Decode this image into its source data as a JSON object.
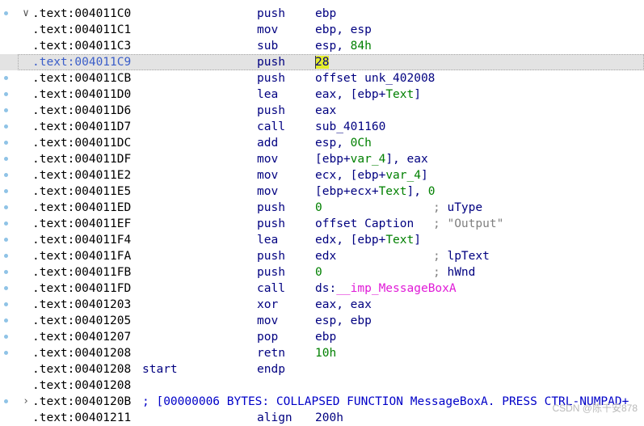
{
  "listing": {
    "rows": [
      {
        "addr": ".text:004011C0",
        "fold": "open",
        "bp": true,
        "mnem": "push",
        "ops": [
          {
            "t": "ebp"
          }
        ]
      },
      {
        "addr": ".text:004011C1",
        "mnem": "mov",
        "ops": [
          {
            "t": "ebp, esp"
          }
        ]
      },
      {
        "addr": ".text:004011C3",
        "mnem": "sub",
        "ops": [
          {
            "t": "esp, "
          },
          {
            "t": "84h",
            "c": "n"
          }
        ]
      },
      {
        "addr": ".text:004011C9",
        "selected": true,
        "mnem": "push",
        "ops": [
          {
            "t": "28",
            "c": "cursor-hl"
          }
        ]
      },
      {
        "addr": ".text:004011CB",
        "bp": true,
        "mnem": "push",
        "ops": [
          {
            "t": "offset unk_402008"
          }
        ]
      },
      {
        "addr": ".text:004011D0",
        "bp": true,
        "mnem": "lea",
        "ops": [
          {
            "t": "eax, [ebp+"
          },
          {
            "t": "Text",
            "c": "var"
          },
          {
            "t": "]"
          }
        ]
      },
      {
        "addr": ".text:004011D6",
        "bp": true,
        "mnem": "push",
        "ops": [
          {
            "t": "eax"
          }
        ]
      },
      {
        "addr": ".text:004011D7",
        "bp": true,
        "mnem": "call",
        "ops": [
          {
            "t": "sub_401160"
          }
        ]
      },
      {
        "addr": ".text:004011DC",
        "bp": true,
        "mnem": "add",
        "ops": [
          {
            "t": "esp, "
          },
          {
            "t": "0Ch",
            "c": "n"
          }
        ]
      },
      {
        "addr": ".text:004011DF",
        "bp": true,
        "mnem": "mov",
        "ops": [
          {
            "t": "[ebp+"
          },
          {
            "t": "var_4",
            "c": "var"
          },
          {
            "t": "], eax"
          }
        ]
      },
      {
        "addr": ".text:004011E2",
        "bp": true,
        "mnem": "mov",
        "ops": [
          {
            "t": "ecx, [ebp+"
          },
          {
            "t": "var_4",
            "c": "var"
          },
          {
            "t": "]"
          }
        ]
      },
      {
        "addr": ".text:004011E5",
        "bp": true,
        "mnem": "mov",
        "ops": [
          {
            "t": "[ebp+ecx+"
          },
          {
            "t": "Text",
            "c": "var"
          },
          {
            "t": "], "
          },
          {
            "t": "0",
            "c": "n"
          }
        ]
      },
      {
        "addr": ".text:004011ED",
        "bp": true,
        "mnem": "push",
        "ops": [
          {
            "t": "0",
            "c": "n"
          }
        ],
        "cmt": [
          {
            "t": "; "
          },
          {
            "t": "uType",
            "c": "cv"
          }
        ]
      },
      {
        "addr": ".text:004011EF",
        "bp": true,
        "mnem": "push",
        "ops": [
          {
            "t": "offset Caption"
          }
        ],
        "cmt": [
          {
            "t": "; \"Output\""
          }
        ]
      },
      {
        "addr": ".text:004011F4",
        "bp": true,
        "mnem": "lea",
        "ops": [
          {
            "t": "edx, [ebp+"
          },
          {
            "t": "Text",
            "c": "var"
          },
          {
            "t": "]"
          }
        ]
      },
      {
        "addr": ".text:004011FA",
        "bp": true,
        "mnem": "push",
        "ops": [
          {
            "t": "edx"
          }
        ],
        "cmt": [
          {
            "t": "; "
          },
          {
            "t": "lpText",
            "c": "cv"
          }
        ]
      },
      {
        "addr": ".text:004011FB",
        "bp": true,
        "mnem": "push",
        "ops": [
          {
            "t": "0",
            "c": "n"
          }
        ],
        "cmt": [
          {
            "t": "; "
          },
          {
            "t": "hWnd",
            "c": "cv"
          }
        ]
      },
      {
        "addr": ".text:004011FD",
        "bp": true,
        "mnem": "call",
        "ops": [
          {
            "t": "ds:"
          },
          {
            "t": "__imp_MessageBoxA",
            "c": "imp"
          }
        ]
      },
      {
        "addr": ".text:00401203",
        "bp": true,
        "mnem": "xor",
        "ops": [
          {
            "t": "eax, eax"
          }
        ]
      },
      {
        "addr": ".text:00401205",
        "bp": true,
        "mnem": "mov",
        "ops": [
          {
            "t": "esp, ebp"
          }
        ]
      },
      {
        "addr": ".text:00401207",
        "bp": true,
        "mnem": "pop",
        "ops": [
          {
            "t": "ebp"
          }
        ]
      },
      {
        "addr": ".text:00401208",
        "bp": true,
        "mnem": "retn",
        "ops": [
          {
            "t": "10h",
            "c": "n"
          }
        ]
      },
      {
        "addr": ".text:00401208",
        "name": "start",
        "mnem": "endp",
        "ops": []
      },
      {
        "addr": ".text:00401208",
        "ops": []
      },
      {
        "addr": ".text:0040120B",
        "fold": "closed",
        "bp": true,
        "fullcmt": "; [00000006 BYTES: COLLAPSED FUNCTION MessageBoxA. PRESS CTRL-NUMPAD+"
      },
      {
        "addr": ".text:00401211",
        "mnem": "align",
        "ops": [
          {
            "t": "200h"
          }
        ]
      }
    ]
  },
  "watermark": "CSDN @陈千安878"
}
